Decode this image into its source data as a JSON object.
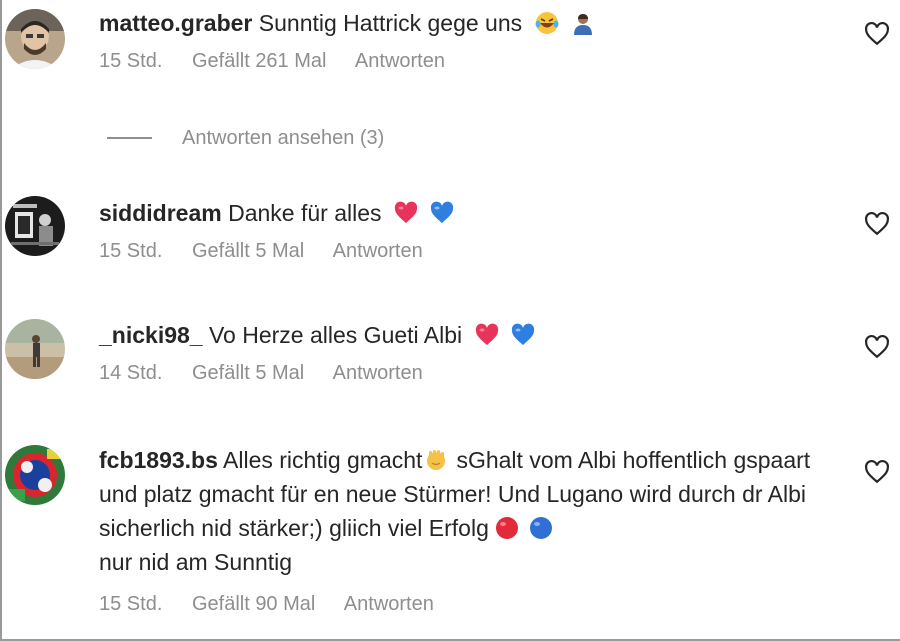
{
  "comments": [
    {
      "username": "matteo.graber",
      "text": "Sunntig Hattrick gege uns",
      "emojis": [
        "laughing-tears-emoji",
        "person-emoji"
      ],
      "time": "15 Std.",
      "likes": "Gefällt 261 Mal",
      "reply": "Antworten"
    },
    {
      "username": "siddidream",
      "text": "Danke für alles",
      "emojis": [
        "red-heart-emoji",
        "blue-heart-emoji"
      ],
      "time": "15 Std.",
      "likes": "Gefällt 5 Mal",
      "reply": "Antworten"
    },
    {
      "username": "_nicki98_",
      "text": "Vo Herze alles Gueti Albi",
      "emojis": [
        "red-heart-emoji",
        "blue-heart-emoji"
      ],
      "time": "14 Std.",
      "likes": "Gefällt 5 Mal",
      "reply": "Antworten"
    },
    {
      "username": "fcb1893.bs",
      "text_part1": "Alles richtig gmacht",
      "text_part2": "sGhalt vom Albi hoffentlich gspaart und platz gmacht für en neue Stürmer! Und Lugano wird durch dr Albi sicherlich nid stärker;) gliich viel Erfolg",
      "text_part3": "nur nid am Sunntig",
      "emojis": [
        "waving-hand-emoji",
        "red-circle-emoji",
        "blue-circle-emoji"
      ],
      "time": "15 Std.",
      "likes": "Gefällt 90 Mal",
      "reply": "Antworten"
    }
  ],
  "view_replies": "Antworten ansehen (3)",
  "colors": {
    "text": "#262626",
    "secondary": "#8e8e8e",
    "red_heart": "#e8335a",
    "blue_heart": "#2f7fe0"
  }
}
